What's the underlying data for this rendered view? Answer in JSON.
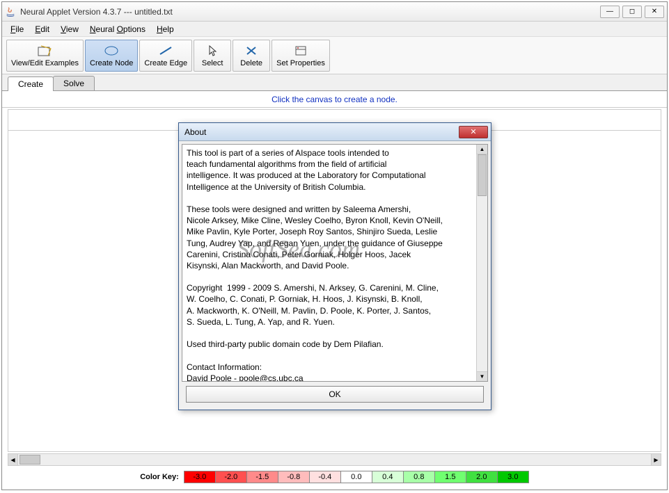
{
  "window": {
    "title": "Neural Applet Version 4.3.7 --- untitled.txt"
  },
  "menubar": {
    "file": "File",
    "edit": "Edit",
    "view": "View",
    "neural_options": "Neural Options",
    "help": "Help"
  },
  "toolbar": {
    "view_edit": "View/Edit Examples",
    "create_node": "Create Node",
    "create_edge": "Create Edge",
    "select": "Select",
    "delete": "Delete",
    "set_properties": "Set Properties"
  },
  "tabs": {
    "create": "Create",
    "solve": "Solve"
  },
  "hint": "Click the canvas to create a node.",
  "color_key": {
    "label": "Color Key:",
    "items": [
      {
        "value": "-3.0",
        "color": "#ff0000",
        "text": "#000"
      },
      {
        "value": "-2.0",
        "color": "#ff5050",
        "text": "#000"
      },
      {
        "value": "-1.5",
        "color": "#ff8a8a",
        "text": "#000"
      },
      {
        "value": "-0.8",
        "color": "#ffbcbc",
        "text": "#000"
      },
      {
        "value": "-0.4",
        "color": "#ffe0e0",
        "text": "#000"
      },
      {
        "value": "0.0",
        "color": "#ffffff",
        "text": "#000"
      },
      {
        "value": "0.4",
        "color": "#d8ffd8",
        "text": "#000"
      },
      {
        "value": "0.8",
        "color": "#a8ffa8",
        "text": "#000"
      },
      {
        "value": "1.5",
        "color": "#70ff70",
        "text": "#000"
      },
      {
        "value": "2.0",
        "color": "#40e040",
        "text": "#000"
      },
      {
        "value": "3.0",
        "color": "#00c800",
        "text": "#000"
      }
    ]
  },
  "about": {
    "title": "About",
    "ok": "OK",
    "text": "This tool is part of a series of AIspace tools intended to\nteach fundamental algorithms from the field of artificial\nintelligence. It was produced at the Laboratory for Computational\nIntelligence at the University of British Columbia.\n\nThese tools were designed and written by Saleema Amershi,\nNicole Arksey, Mike Cline, Wesley Coelho, Byron Knoll, Kevin O'Neill,\nMike Pavlin, Kyle Porter, Joseph Roy Santos, Shinjiro Sueda, Leslie\nTung, Audrey Yap, and Regan Yuen, under the guidance of Giuseppe\nCarenini, Cristina Conati, Peter Gorniak, Holger Hoos, Jacek\nKisynski, Alan Mackworth, and David Poole.\n\nCopyright  1999 - 2009 S. Amershi, N. Arksey, G. Carenini, M. Cline,\nW. Coelho, C. Conati, P. Gorniak, H. Hoos, J. Kisynski, B. Knoll,\nA. Mackworth, K. O'Neill, M. Pavlin, D. Poole, K. Porter, J. Santos,\nS. Sueda, L. Tung, A. Yap, and R. Yuen.\n\nUsed third-party public domain code by Dem Pilafian.\n\nContact Information:\nDavid Poole - poole@cs.ubc.ca"
  },
  "watermark": "SoftSea.com"
}
